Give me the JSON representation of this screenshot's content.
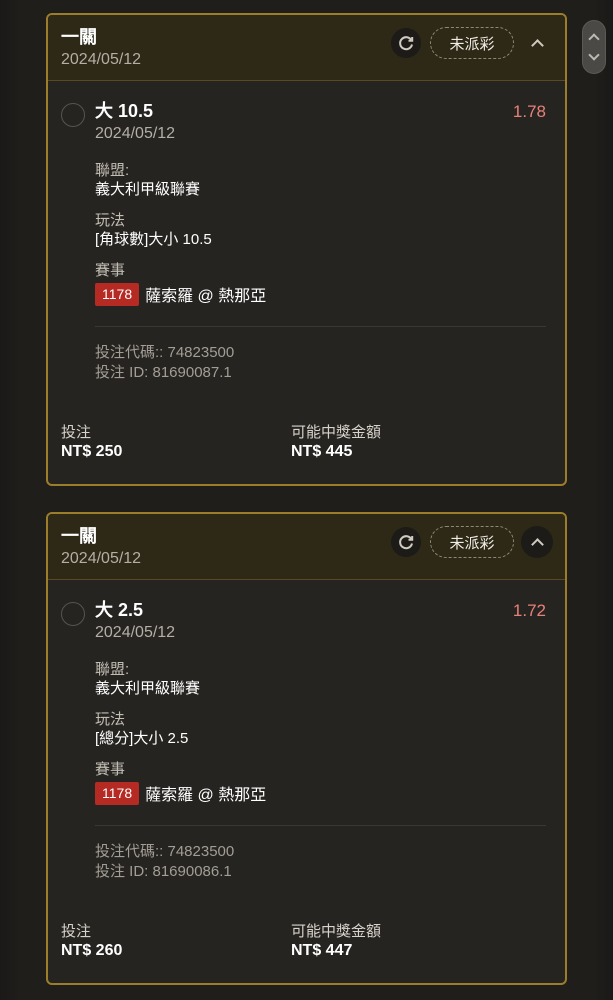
{
  "tickets": [
    {
      "header": {
        "title": "一關",
        "date": "2024/05/12",
        "status_label": "未派彩"
      },
      "selection": {
        "name": "大 10.5",
        "date": "2024/05/12",
        "odds": "1.78",
        "league_label": "聯盟:",
        "league_value": "義大利甲級聯賽",
        "play_label": "玩法",
        "play_value": "[角球數]大小 10.5",
        "event_label": "賽事",
        "match_id": "1178",
        "match_name": "薩索羅 @ 熱那亞",
        "bet_code": "投注代碼:: 74823500",
        "bet_id": "投注 ID: 81690087.1"
      },
      "footer": {
        "stake_label": "投注",
        "stake_value": "NT$ 250",
        "payout_label": "可能中獎金額",
        "payout_value": "NT$ 445"
      }
    },
    {
      "header": {
        "title": "一關",
        "date": "2024/05/12",
        "status_label": "未派彩"
      },
      "selection": {
        "name": "大 2.5",
        "date": "2024/05/12",
        "odds": "1.72",
        "league_label": "聯盟:",
        "league_value": "義大利甲級聯賽",
        "play_label": "玩法",
        "play_value": "[總分]大小 2.5",
        "event_label": "賽事",
        "match_id": "1178",
        "match_name": "薩索羅 @ 熱那亞",
        "bet_code": "投注代碼:: 74823500",
        "bet_id": "投注 ID: 81690086.1"
      },
      "footer": {
        "stake_label": "投注",
        "stake_value": "NT$ 260",
        "payout_label": "可能中獎金額",
        "payout_value": "NT$ 447"
      }
    }
  ],
  "colors": {
    "accent_border": "#9c7d2a",
    "odds": "#e8807a",
    "match_badge": "#b52a22"
  },
  "icons": [
    "refresh-icon",
    "chevron-up-icon",
    "scroll-up-icon",
    "scroll-down-icon"
  ]
}
